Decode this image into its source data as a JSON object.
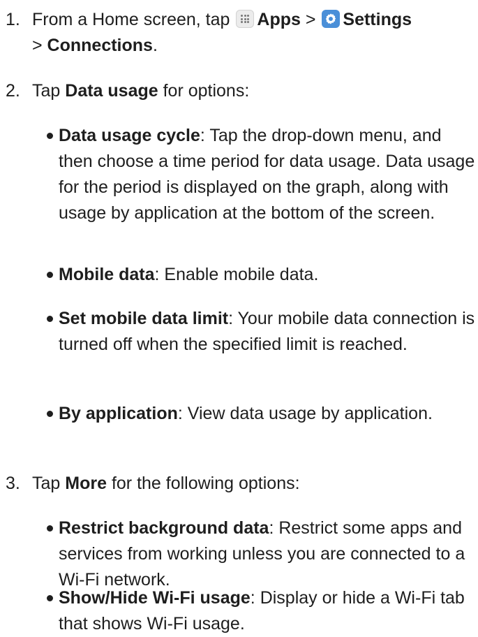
{
  "steps": [
    {
      "number": "1.",
      "segments": {
        "t1": "From a Home screen, tap ",
        "apps": "Apps",
        "sep1": " > ",
        "settings": "Settings",
        "sep2": "> ",
        "connections": "Connections",
        "end": "."
      },
      "icons": [
        "apps-grid-icon",
        "settings-gear-icon"
      ]
    },
    {
      "number": "2.",
      "pre": "Tap ",
      "bold": "Data usage",
      "post": " for options:",
      "bullets": [
        {
          "term": "Data usage cycle",
          "desc": ": Tap the drop-down menu, and then choose a time period for data usage. Data usage for the period is displayed on the graph, along with usage by application at the bottom of the screen."
        },
        {
          "term": "Mobile data",
          "desc": ": Enable mobile data."
        },
        {
          "term": "Set mobile data limit",
          "desc": ": Your mobile data connection is turned off when the specified limit is reached."
        },
        {
          "term": "By application",
          "desc": ": View data usage by application."
        }
      ]
    },
    {
      "number": "3.",
      "pre": "Tap ",
      "bold": "More",
      "post": " for the following options:",
      "bullets": [
        {
          "term": "Restrict background data",
          "desc": ": Restrict some apps and services from working unless you are connected to a Wi-Fi network."
        },
        {
          "term": "Show/Hide Wi-Fi usage",
          "desc": ": Display or hide a Wi-Fi tab that shows Wi-Fi usage."
        }
      ]
    }
  ],
  "colors": {
    "text": "#1e1e1e",
    "settings_icon": "#4a8fd8",
    "apps_icon_bg": "#ececec"
  }
}
